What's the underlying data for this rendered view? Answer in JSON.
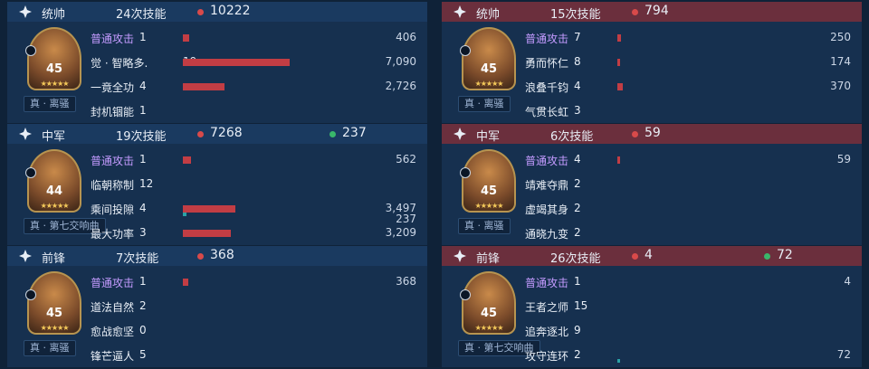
{
  "colors": {
    "damage": "#c23d44",
    "heal": "#39b76a",
    "basic_attack": "#c49bff",
    "header_left": "#1a3a60",
    "header_right": "#6b2f3d"
  },
  "left": {
    "blocks": [
      {
        "role": "统帅",
        "skills_text": "24次技能",
        "damage": "10222",
        "heal": "",
        "level": "45",
        "tag": "真 · 离骚",
        "rows": [
          {
            "name": "普通攻击",
            "count": "1",
            "value": "406",
            "basic": true,
            "bar": 0.035
          },
          {
            "name": "觉 · 智略多.",
            "count": "19",
            "value": "7,090",
            "bar": 0.59
          },
          {
            "name": "一竟全功",
            "count": "4",
            "value": "2,726",
            "bar": 0.23
          },
          {
            "name": "封机锢能",
            "count": "1",
            "value": "",
            "bar": 0
          }
        ]
      },
      {
        "role": "中军",
        "skills_text": "19次技能",
        "damage": "7268",
        "heal": "237",
        "level": "44",
        "tag": "真 · 第七交响曲",
        "rows": [
          {
            "name": "普通攻击",
            "count": "1",
            "value": "562",
            "basic": true,
            "bar": 0.045
          },
          {
            "name": "临朝称制",
            "count": "12",
            "value": "",
            "bar": 0
          },
          {
            "name": "乘间投隙",
            "count": "4",
            "value": "3,497",
            "value2": "237",
            "bar": 0.29,
            "bar2": 0.02
          },
          {
            "name": "最大功率",
            "count": "3",
            "value": "3,209",
            "bar": 0.265
          }
        ]
      },
      {
        "role": "前锋",
        "skills_text": "7次技能",
        "damage": "368",
        "heal": "",
        "level": "45",
        "tag": "真 · 离骚",
        "rows": [
          {
            "name": "普通攻击",
            "count": "1",
            "value": "368",
            "basic": true,
            "bar": 0.032
          },
          {
            "name": "道法自然",
            "count": "2",
            "value": "",
            "bar": 0
          },
          {
            "name": "愈战愈坚",
            "count": "0",
            "value": "",
            "bar": 0
          },
          {
            "name": "锋芒逼人",
            "count": "5",
            "value": "",
            "bar": 0
          }
        ]
      }
    ]
  },
  "right": {
    "blocks": [
      {
        "role": "统帅",
        "skills_text": "15次技能",
        "damage": "794",
        "heal": "",
        "level": "45",
        "tag": "真 · 离骚",
        "rows": [
          {
            "name": "普通攻击",
            "count": "7",
            "value": "250",
            "basic": true,
            "bar": 0.02
          },
          {
            "name": "勇而怀仁",
            "count": "8",
            "value": "174",
            "bar": 0.014
          },
          {
            "name": "浪叠千钧",
            "count": "4",
            "value": "370",
            "bar": 0.03
          },
          {
            "name": "气贯长虹",
            "count": "3",
            "value": "",
            "bar": 0
          }
        ]
      },
      {
        "role": "中军",
        "skills_text": "6次技能",
        "damage": "59",
        "heal": "",
        "level": "45",
        "tag": "真 · 离骚",
        "rows": [
          {
            "name": "普通攻击",
            "count": "4",
            "value": "59",
            "basic": true,
            "bar": 0.006
          },
          {
            "name": "靖难夺鼎",
            "count": "2",
            "value": "",
            "bar": 0
          },
          {
            "name": "虚竭其身",
            "count": "2",
            "value": "",
            "bar": 0
          },
          {
            "name": "通晓九变",
            "count": "2",
            "value": "",
            "bar": 0
          }
        ]
      },
      {
        "role": "前锋",
        "skills_text": "26次技能",
        "damage": "4",
        "heal": "72",
        "level": "45",
        "tag": "真 · 第七交响曲",
        "rows": [
          {
            "name": "普通攻击",
            "count": "1",
            "value": "4",
            "basic": true,
            "bar": 0
          },
          {
            "name": "王者之师",
            "count": "15",
            "value": "",
            "bar": 0
          },
          {
            "name": "追奔逐北",
            "count": "9",
            "value": "",
            "bar": 0
          },
          {
            "name": "攻守连环",
            "count": "2",
            "value": "72",
            "bar": 0,
            "bar2": 0.006
          }
        ]
      }
    ]
  }
}
